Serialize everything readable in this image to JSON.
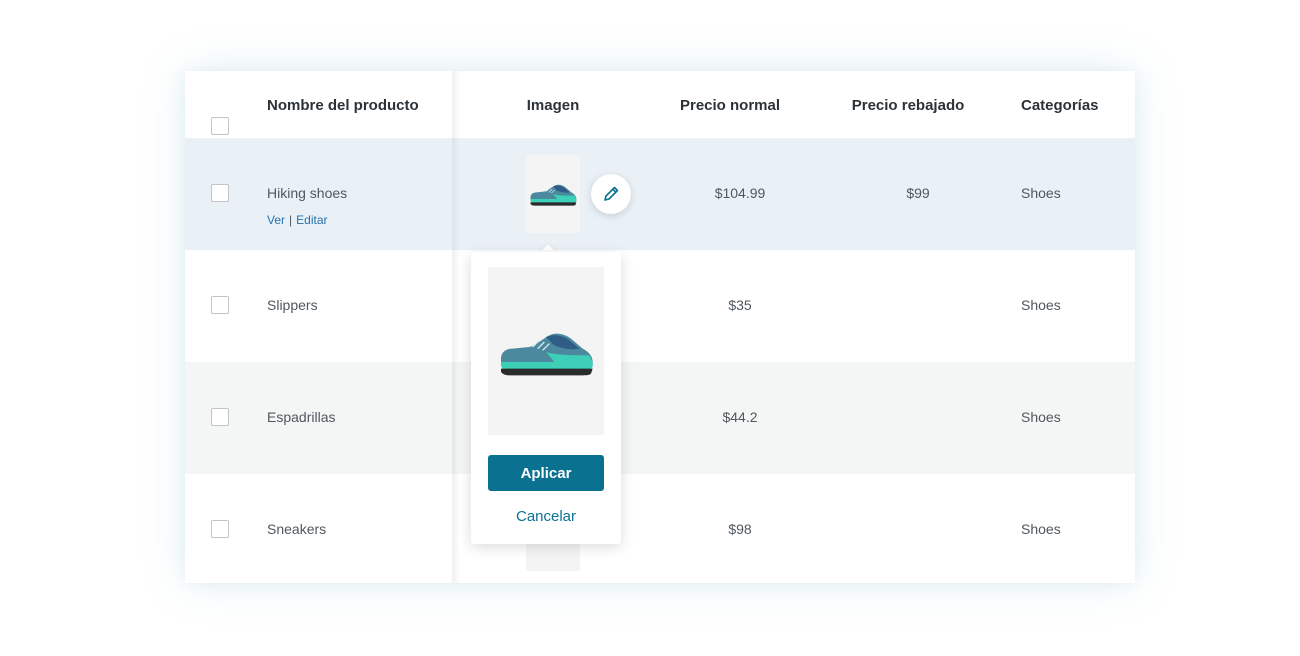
{
  "table": {
    "headers": {
      "product_name": "Nombre del producto",
      "image": "Imagen",
      "regular_price": "Precio normal",
      "sale_price": "Precio rebajado",
      "categories": "Categorías"
    },
    "rows": [
      {
        "name": "Hiking shoes",
        "regular_price": "$104.99",
        "sale_price": "$99",
        "category": "Shoes",
        "actions": {
          "view": "Ver",
          "edit": "Editar"
        }
      },
      {
        "name": "Slippers",
        "regular_price": "$35",
        "sale_price": "",
        "category": "Shoes"
      },
      {
        "name": "Espadrillas",
        "regular_price": "$44.2",
        "sale_price": "",
        "category": "Shoes"
      },
      {
        "name": "Sneakers",
        "regular_price": "$98",
        "sale_price": "",
        "category": "Shoes"
      }
    ]
  },
  "popover": {
    "apply_label": "Aplicar",
    "cancel_label": "Cancelar"
  },
  "icons": {
    "edit": "pencil-icon",
    "product_image": "shoe-image"
  },
  "colors": {
    "accent": "#0b7191",
    "link": "#2271b1",
    "selected_row": "#eaf1f6",
    "alt_row": "#f4f6f6"
  }
}
